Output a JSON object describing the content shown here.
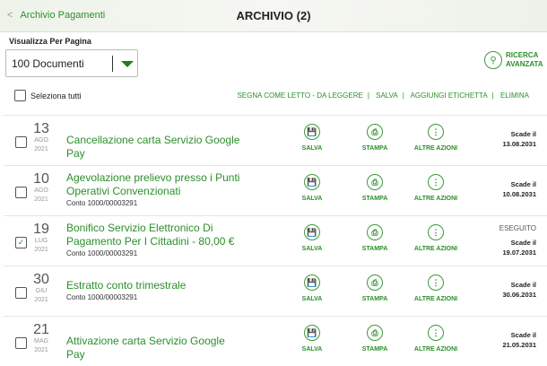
{
  "header": {
    "back_label": "Archivio Pagamenti",
    "title": "ARCHIVIO (2)"
  },
  "toolbar": {
    "per_page_label": "Visualizza Per Pagina",
    "per_page_value": "100 Documenti",
    "search_line1": "RICERCA",
    "search_line2": "AVANZATA",
    "select_all": "Seleziona tutti",
    "actions": [
      "SEGNA COME LETTO - DA LEGGERE",
      "SALVA",
      "AGGIUNGI ETICHETTA",
      "ELIMINA"
    ],
    "separator": "|"
  },
  "action_labels": {
    "save": "SALVA",
    "print": "STAMPA",
    "more": "ALTRE AZIONI"
  },
  "rows": [
    {
      "day": "13",
      "month": "AGO",
      "year": "2021",
      "title": "Cancellazione carta Servizio Google Pay",
      "sub": "",
      "status": "",
      "expiry_label": "Scade il",
      "expiry": "13.08.2031",
      "checked": false
    },
    {
      "day": "10",
      "month": "AGO",
      "year": "2021",
      "title": "Agevolazione prelievo presso i Punti Operativi Convenzionati",
      "sub": "Conto 1000/00003291",
      "status": "",
      "expiry_label": "Scade il",
      "expiry": "10.08.2031",
      "checked": false
    },
    {
      "day": "19",
      "month": "LUG",
      "year": "2021",
      "title": "Bonifico Servizio Elettronico Di Pagamento Per I Cittadini - 80,00 €",
      "sub": "Conto 1000/00003291",
      "status": "ESEGUITO",
      "expiry_label": "Scade il",
      "expiry": "19.07.2031",
      "checked": true
    },
    {
      "day": "30",
      "month": "GIU",
      "year": "2021",
      "title": "Estratto conto trimestrale",
      "sub": "Conto 1000/00003291",
      "status": "",
      "expiry_label": "Scade il",
      "expiry": "30.06.2031",
      "checked": false
    },
    {
      "day": "21",
      "month": "MAG",
      "year": "2021",
      "title": "Attivazione carta Servizio Google Pay",
      "sub": "",
      "status": "",
      "expiry_label": "Scade il",
      "expiry": "21.05.2031",
      "checked": false
    }
  ]
}
